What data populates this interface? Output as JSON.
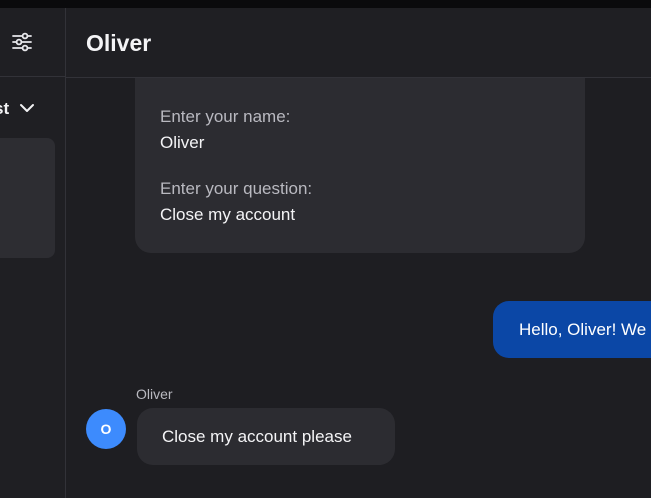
{
  "sidebar": {
    "sort_label": "st",
    "icons": {
      "settings": "sliders-icon",
      "sort_toggle": "chevron-down-icon"
    }
  },
  "header": {
    "title": "Oliver"
  },
  "form_card": {
    "name_label": "Enter your name:",
    "name_value": "Oliver",
    "question_label": "Enter your question:",
    "question_value": "Close my account"
  },
  "bot_message": {
    "text": "Hello, Oliver! We"
  },
  "user_message": {
    "sender": "Oliver",
    "avatar_initial": "O",
    "text": "Close my account please"
  },
  "colors": {
    "background": "#1e1e22",
    "panel": "#1f1f23",
    "card": "#2c2c31",
    "bot_bubble": "#0b47a6",
    "avatar": "#3d8bfd",
    "border": "#323238"
  }
}
